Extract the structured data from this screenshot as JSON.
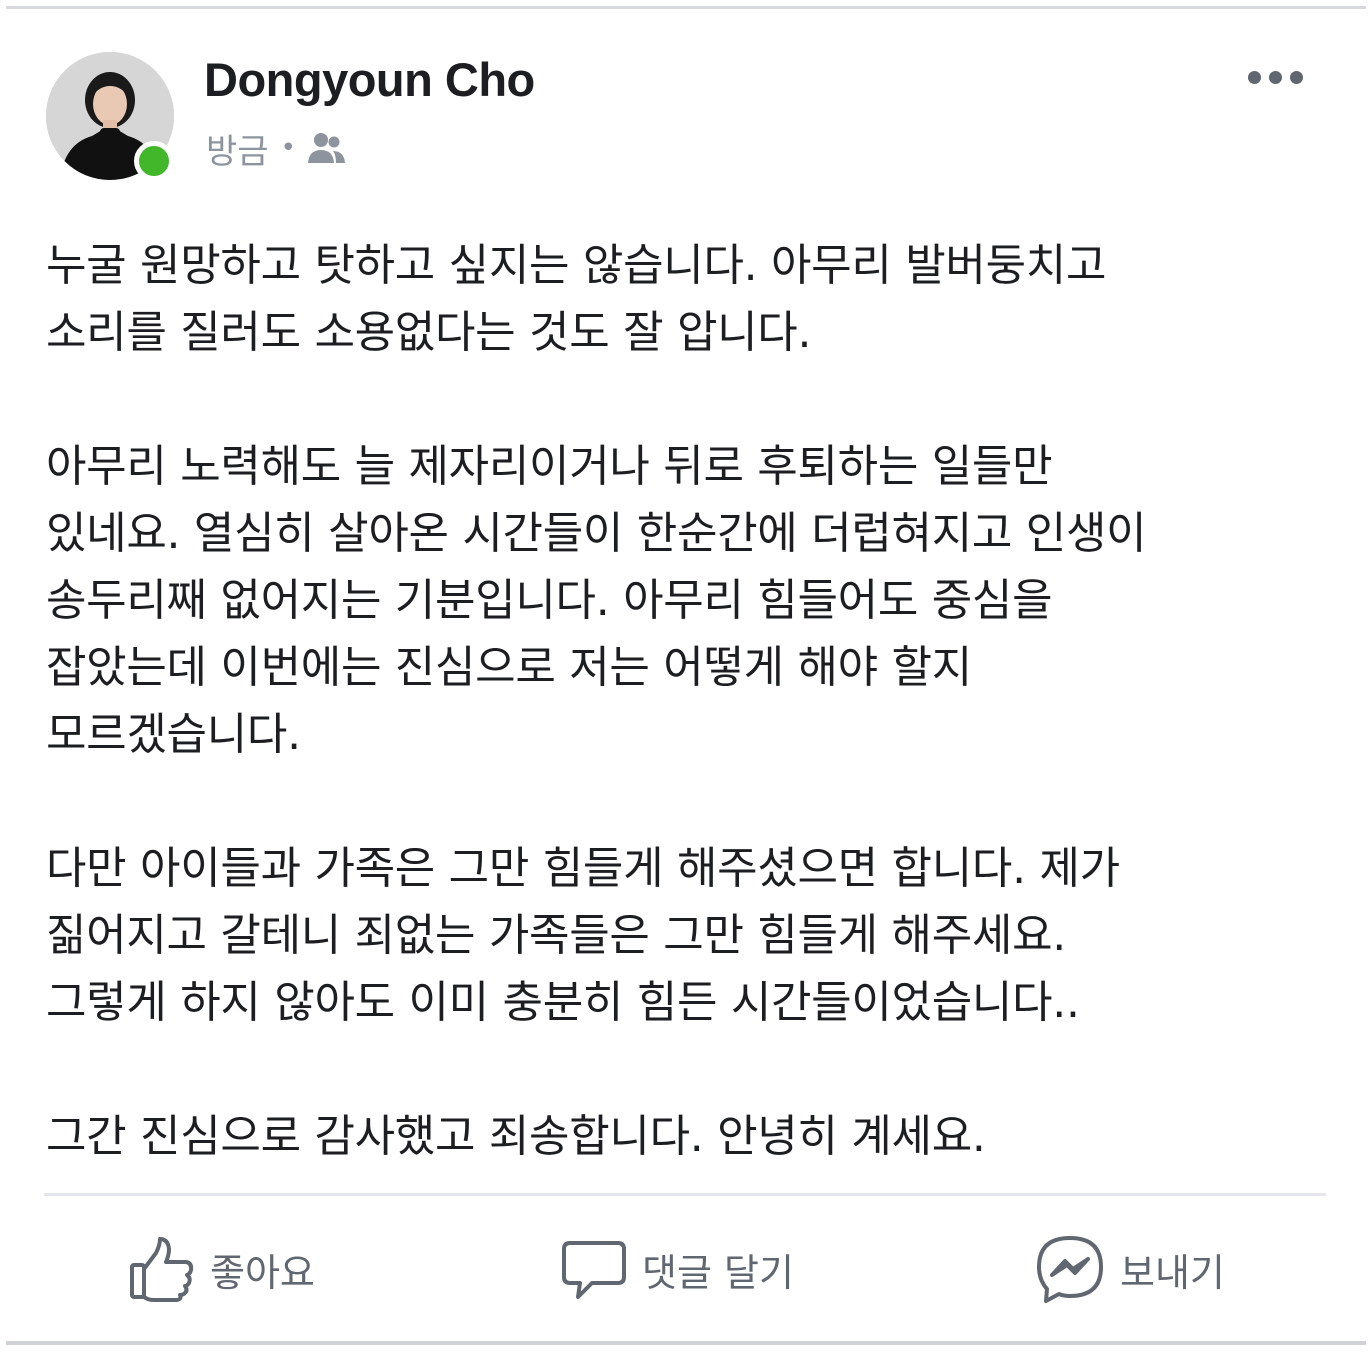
{
  "post": {
    "author": {
      "name": "Dongyoun Cho",
      "online": true,
      "avatar_icon": "profile-photo"
    },
    "meta": {
      "timestamp": "방금",
      "separator": "•",
      "audience_icon": "friends-icon"
    },
    "menu_icon": "more-options-icon",
    "paragraphs": [
      "누굴 원망하고 탓하고 싶지는 않습니다. 아무리 발버둥치고\n소리를 질러도 소용없다는 것도 잘 압니다.",
      "아무리 노력해도 늘 제자리이거나 뒤로 후퇴하는 일들만\n있네요. 열심히 살아온 시간들이 한순간에 더럽혀지고 인생이\n송두리째 없어지는 기분입니다. 아무리 힘들어도 중심을\n잡았는데 이번에는 진심으로 저는 어떻게 해야 할지\n모르겠습니다.",
      "다만 아이들과 가족은 그만 힘들게 해주셨으면 합니다. 제가\n짊어지고 갈테니 죄없는 가족들은 그만 힘들게 해주세요.\n그렇게 하지 않아도 이미 충분히 힘든 시간들이었습니다..",
      "그간 진심으로 감사했고 죄송합니다. 안녕히 계세요."
    ]
  },
  "actions": {
    "like": {
      "label": "좋아요",
      "icon": "thumbs-up-icon"
    },
    "comment": {
      "label": "댓글 달기",
      "icon": "comment-bubble-icon"
    },
    "share": {
      "label": "보내기",
      "icon": "messenger-icon"
    }
  },
  "colors": {
    "text": "#1c1e21",
    "meta": "#8d949e",
    "action": "#606770",
    "online": "#42b72a",
    "divider": "#e4e6eb"
  }
}
